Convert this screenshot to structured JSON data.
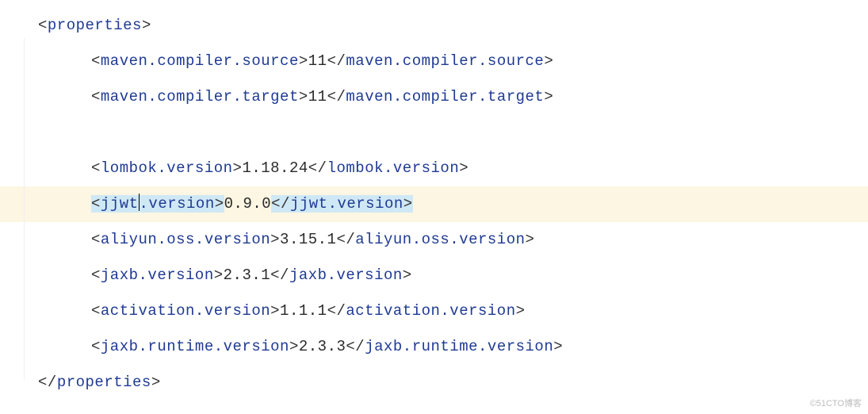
{
  "xml": {
    "root_open": "properties",
    "root_close": "properties",
    "lines": [
      {
        "tag": "maven.compiler.source",
        "value": "11"
      },
      {
        "tag": "maven.compiler.target",
        "value": "11"
      },
      {
        "tag": "lombok.version",
        "value": "1.18.24"
      },
      {
        "tag": "jjwt.version",
        "value": "0.9.0",
        "highlighted": true,
        "selected_tag": true,
        "cursor_after": "jjwt"
      },
      {
        "tag": "aliyun.oss.version",
        "value": "3.15.1"
      },
      {
        "tag": "jaxb.version",
        "value": "2.3.1"
      },
      {
        "tag": "activation.version",
        "value": "1.1.1"
      },
      {
        "tag": "jaxb.runtime.version",
        "value": "2.3.3"
      }
    ]
  },
  "watermark": "©51CTO博客"
}
